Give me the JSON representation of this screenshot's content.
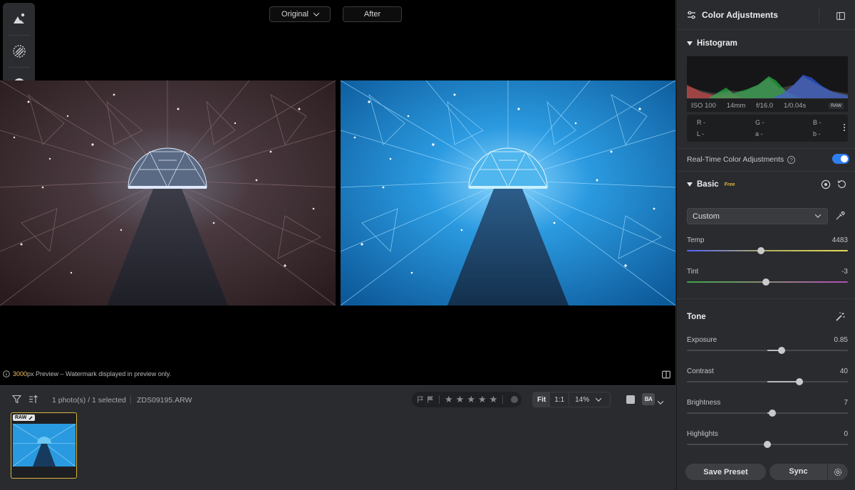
{
  "compare": {
    "original_label": "Original",
    "after_label": "After"
  },
  "tool_rail": {
    "items": [
      "edit-icon",
      "masking-icon",
      "history-icon"
    ]
  },
  "preview_note": {
    "highlight": "3000",
    "text": "px Preview – Watermark displayed in preview only."
  },
  "filmstrip": {
    "count": "1 photo(s) / 1 selected",
    "filename": "ZDS09195.ARW",
    "stars": [
      "★",
      "★",
      "★",
      "★",
      "★"
    ],
    "zoom": {
      "fit": "Fit",
      "one_to_one": "1:1",
      "percent": "14%"
    },
    "view_ba": "BA",
    "thumb_badge": "RAW"
  },
  "panel": {
    "title": "Color Adjustments",
    "histogram": {
      "title": "Histogram",
      "iso": "ISO 100",
      "focal": "14mm",
      "aperture": "f/16.0",
      "shutter": "1/0.04s",
      "raw": "RAW",
      "readout": {
        "r": "R -",
        "g": "G -",
        "b": "B -",
        "l": "L -",
        "a": "a -",
        "bb": "b -"
      }
    },
    "realtime": {
      "label": "Real-Time Color Adjustments",
      "help": "?",
      "enabled": true
    },
    "basic": {
      "title": "Basic",
      "badge": "Free",
      "wb_preset": "Custom",
      "temp": {
        "label": "Temp",
        "value": "4483",
        "position": 0.46
      },
      "tint": {
        "label": "Tint",
        "value": "-3",
        "position": 0.49
      }
    },
    "tone": {
      "title": "Tone",
      "exposure": {
        "label": "Exposure",
        "value": "0.85",
        "position": 0.59
      },
      "contrast": {
        "label": "Contrast",
        "value": "40",
        "position": 0.7
      },
      "brightness": {
        "label": "Brightness",
        "value": "7",
        "position": 0.53
      },
      "highlights": {
        "label": "Highlights",
        "value": "0",
        "position": 0.5
      }
    },
    "footer": {
      "save_preset": "Save Preset",
      "sync": "Sync"
    }
  },
  "colors": {
    "accent": "#2e7ff0",
    "selection": "#d9b53a",
    "free_badge": "#e0b83a"
  }
}
